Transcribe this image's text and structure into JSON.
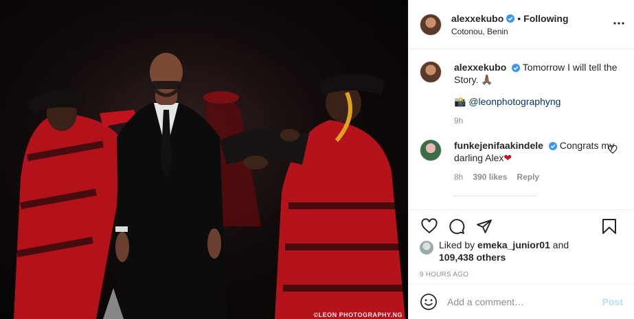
{
  "photo": {
    "watermark": "©LEON PHOTOGRAPHY.NG"
  },
  "header": {
    "username": "alexxekubo",
    "separator": "•",
    "follow_state": "Following",
    "location": "Cotonou, Benin"
  },
  "caption": {
    "username": "alexxekubo",
    "text": "Tomorrow I will tell the Story. ",
    "emoji": "🙏🏾",
    "credit_emoji": "📸",
    "credit_mention": "@leonphotographyng",
    "time": "9h"
  },
  "comments": [
    {
      "username": "funkejenifaakindele",
      "text": "Congrats my darling Alex",
      "heart": "❤",
      "time": "8h",
      "likes": "390 likes",
      "reply_label": "Reply"
    }
  ],
  "likes": {
    "prefix": "Liked by ",
    "user": "emeka_junior01",
    "and": " and",
    "others": "109,438 others"
  },
  "timestamp": "9 HOURS AGO",
  "add_comment": {
    "placeholder": "Add a comment…",
    "post_label": "Post"
  },
  "icons": {
    "verified": "verified-badge-icon",
    "more": "more-options-icon",
    "like": "heart-icon",
    "comment": "comment-icon",
    "share": "paper-plane-icon",
    "save": "bookmark-icon",
    "emoji": "emoji-icon"
  },
  "colors": {
    "verified": "#3897f0",
    "link": "#00376b",
    "muted": "#8e8e8e",
    "post_disabled": "#b2dffc",
    "robe_red": "#c8101a"
  }
}
